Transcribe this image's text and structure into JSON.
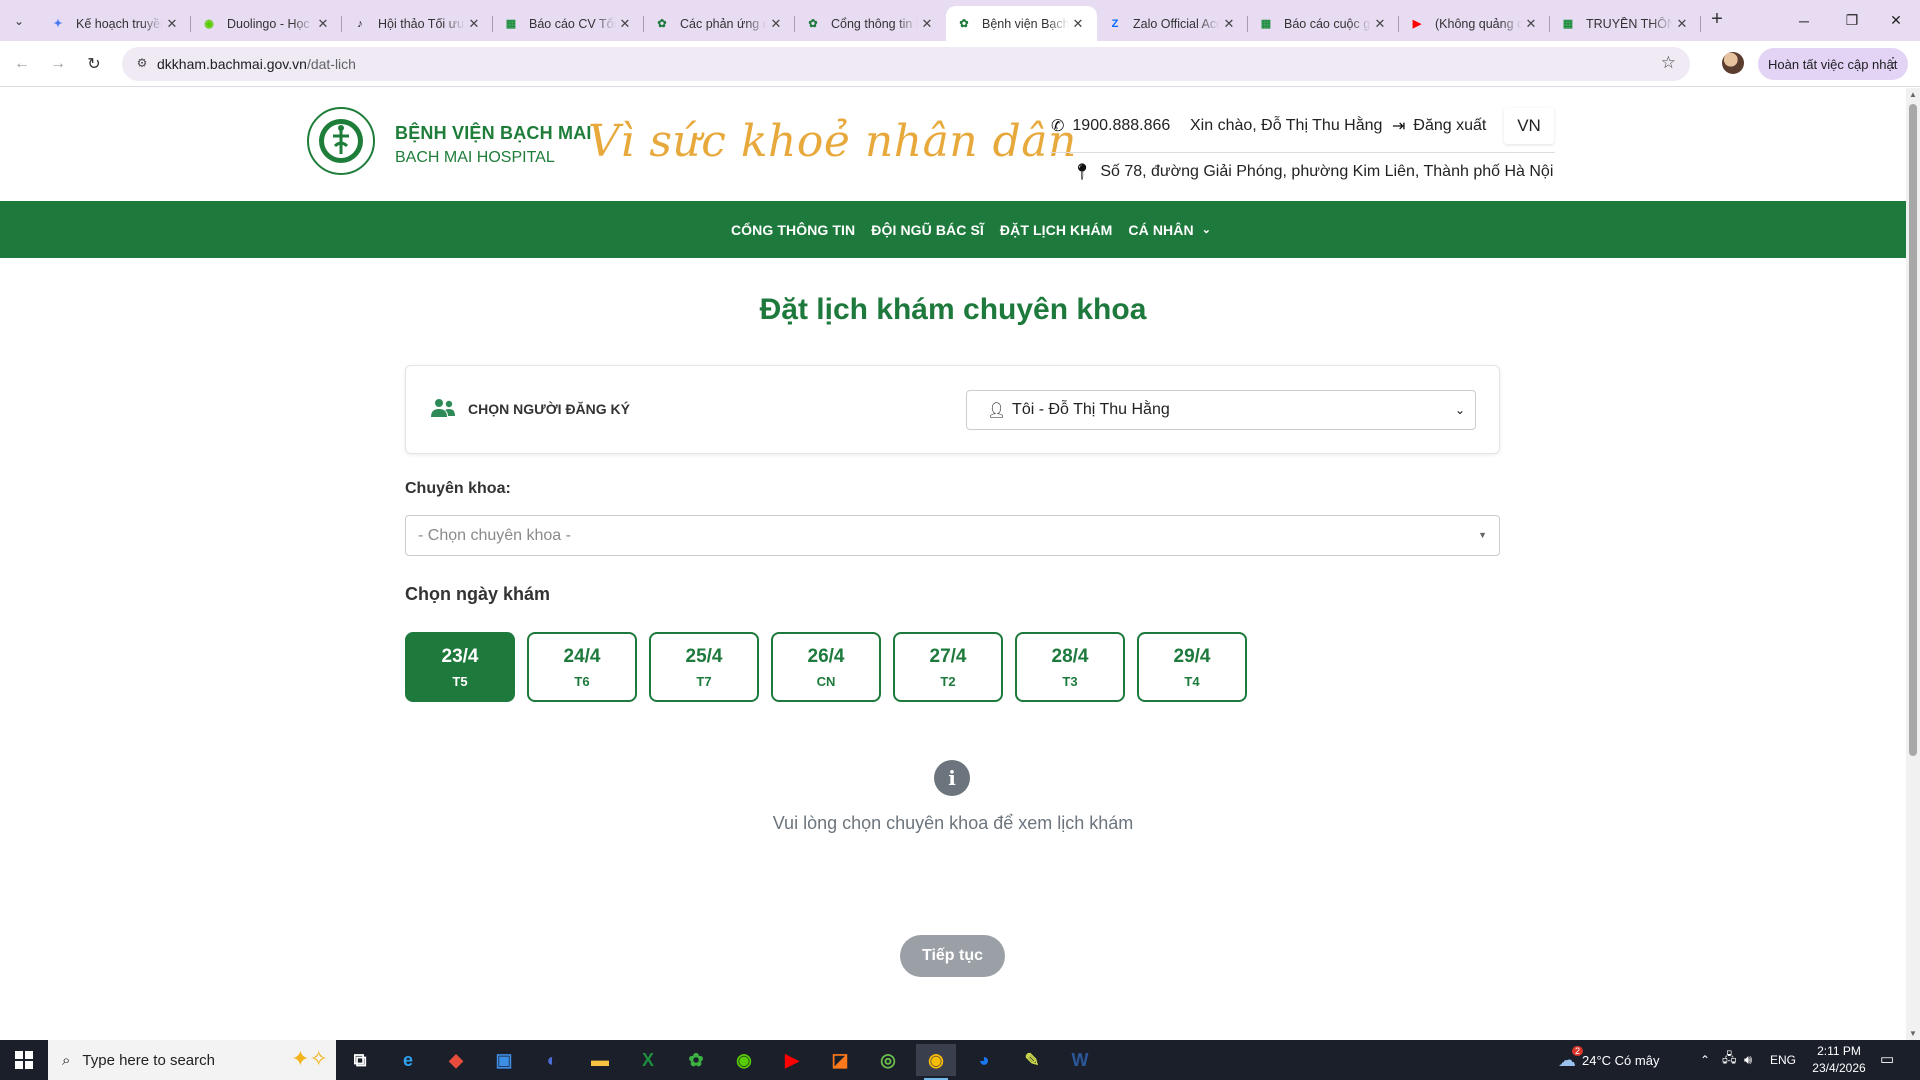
{
  "browser": {
    "tabs": [
      {
        "title": "Kế hoạch truyền thông",
        "icon": "gemini-icon",
        "color": "#4a7cf0",
        "glyph": "✦"
      },
      {
        "title": "Duolingo - Học ngoại ngữ",
        "icon": "duolingo-icon",
        "color": "#58cc02",
        "glyph": "◉"
      },
      {
        "title": "Hội thảo Tối ưu hóa",
        "icon": "tiktok-icon",
        "color": "#111111",
        "glyph": "♪"
      },
      {
        "title": "Báo cáo CV Tổng hợp",
        "icon": "sheets-icon",
        "color": "#1e8e3e",
        "glyph": "▦"
      },
      {
        "title": "Các phản ứng của thuốc",
        "icon": "bachmai-icon",
        "color": "#1e7a3c",
        "glyph": "✿"
      },
      {
        "title": "Cổng thông tin Bạch Mai",
        "icon": "bachmai-icon",
        "color": "#1e7a3c",
        "glyph": "✿"
      },
      {
        "title": "Bệnh viện Bạch Mai",
        "icon": "bachmai-icon",
        "color": "#1e7a3c",
        "glyph": "✿",
        "active": true
      },
      {
        "title": "Zalo Official Account",
        "icon": "zalo-icon",
        "color": "#0068ff",
        "glyph": "Z"
      },
      {
        "title": "Báo cáo cuộc gọi",
        "icon": "sheets-icon",
        "color": "#1e8e3e",
        "glyph": "▦"
      },
      {
        "title": "(Không quảng cáo)",
        "icon": "youtube-icon",
        "color": "#ff0000",
        "glyph": "▶"
      },
      {
        "title": "TRUYỀN THÔNG",
        "icon": "sheets-icon",
        "color": "#1e8e3e",
        "glyph": "▦"
      }
    ],
    "url_host": "dkkham.bachmai.gov.vn",
    "url_path": "/dat-lich",
    "update_label": "Hoàn tất việc cập nhật"
  },
  "header": {
    "hospital_name_vi": "BỆNH VIỆN BẠCH MAI",
    "hospital_name_en": "BACH MAI HOSPITAL",
    "slogan": "Vì sức khoẻ nhân dân",
    "hotline": "1900.888.866",
    "greeting": "Xin chào, Đỗ Thị Thu Hằng",
    "logout": "Đăng xuất",
    "language": "VN",
    "address": "Số 78, đường Giải Phóng, phường Kim Liên, Thành phố Hà Nội"
  },
  "nav": {
    "items": [
      "CỔNG THÔNG TIN",
      "ĐỘI NGŨ BÁC SĨ",
      "ĐẶT LỊCH KHÁM",
      "CÁ NHÂN"
    ]
  },
  "main": {
    "title": "Đặt lịch khám chuyên khoa",
    "registrant_label": "CHỌN NGƯỜI ĐĂNG KÝ",
    "registrant_value": "Tôi - Đỗ Thị Thu Hằng",
    "specialty_label": "Chuyên khoa:",
    "specialty_placeholder": "- Chọn chuyên khoa -",
    "date_label": "Chọn ngày khám",
    "dates": [
      {
        "date": "23/4",
        "weekday": "T5",
        "selected": true
      },
      {
        "date": "24/4",
        "weekday": "T6"
      },
      {
        "date": "25/4",
        "weekday": "T7"
      },
      {
        "date": "26/4",
        "weekday": "CN"
      },
      {
        "date": "27/4",
        "weekday": "T2"
      },
      {
        "date": "28/4",
        "weekday": "T3"
      },
      {
        "date": "29/4",
        "weekday": "T4"
      }
    ],
    "info_message": "Vui lòng chọn chuyên khoa để xem lịch khám",
    "continue_label": "Tiếp tục"
  },
  "taskbar": {
    "search_placeholder": "Type here to search",
    "weather": "24°C Có mây",
    "weather_badge": "2",
    "language": "ENG",
    "time": "2:11 PM",
    "date": "23/4/2026",
    "apps": [
      {
        "name": "task-view-icon",
        "glyph": "⧉",
        "color": "#ffffff"
      },
      {
        "name": "edge-icon",
        "glyph": "e",
        "color": "#2ea3f2"
      },
      {
        "name": "app-red-icon",
        "glyph": "◆",
        "color": "#e74c3c"
      },
      {
        "name": "store-icon",
        "glyph": "▣",
        "color": "#3d8ee6"
      },
      {
        "name": "app-blue-icon",
        "glyph": "◐",
        "color": "#4a6cd4"
      },
      {
        "name": "file-explorer-icon",
        "glyph": "▬",
        "color": "#f5c542"
      },
      {
        "name": "excel-icon",
        "glyph": "X",
        "color": "#1e8e3e"
      },
      {
        "name": "app-green-icon",
        "glyph": "✿",
        "color": "#3cb043"
      },
      {
        "name": "duolingo-icon",
        "glyph": "◉",
        "color": "#58cc02"
      },
      {
        "name": "youtube-icon",
        "glyph": "▶",
        "color": "#ff0000"
      },
      {
        "name": "app-orange-icon",
        "glyph": "◪",
        "color": "#ff7a1a"
      },
      {
        "name": "app-lime-icon",
        "glyph": "◎",
        "color": "#6abf4b"
      },
      {
        "name": "chrome-icon",
        "glyph": "◉",
        "color": "#fbbc05",
        "active": true
      },
      {
        "name": "messenger-icon",
        "glyph": "◕",
        "color": "#1877f2"
      },
      {
        "name": "app-yellow-icon",
        "glyph": "✎",
        "color": "#c9d64a"
      },
      {
        "name": "word-icon",
        "glyph": "W",
        "color": "#2b579a"
      }
    ]
  }
}
